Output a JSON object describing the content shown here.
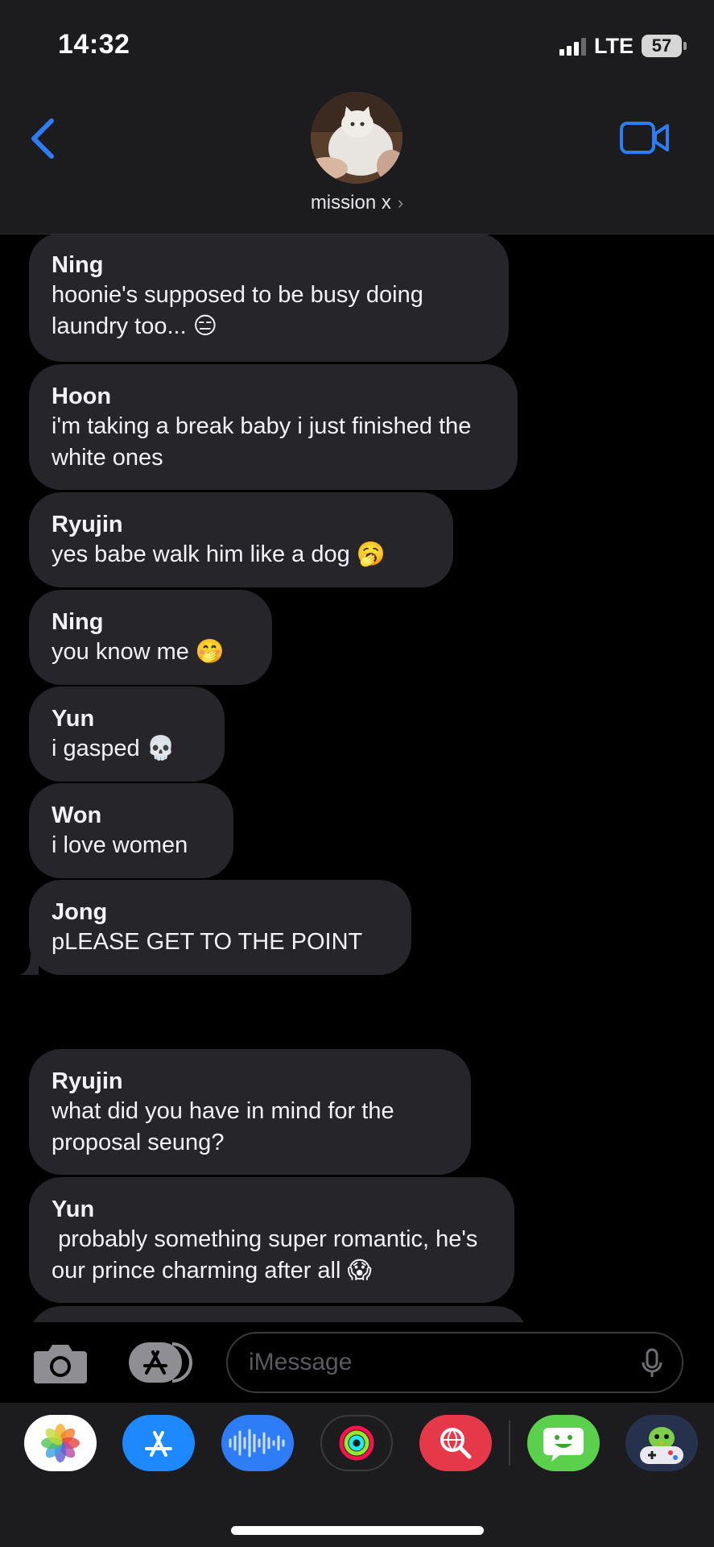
{
  "status_bar": {
    "time": "14:32",
    "network": "LTE",
    "battery": "57"
  },
  "header": {
    "group_name": "mission x",
    "chevron": "›"
  },
  "messages": [
    {
      "sender": "Ning",
      "text": "hoonie's supposed to be busy doing laundry too... 😑"
    },
    {
      "sender": "Hoon",
      "text": "i'm taking a break baby i just finished the white ones"
    },
    {
      "sender": "Ryujin",
      "text": "yes babe walk him like a dog 🥱"
    },
    {
      "sender": "Ning",
      "text": "you know me 🤭"
    },
    {
      "sender": "Yun",
      "text": "i gasped 💀"
    },
    {
      "sender": "Won",
      "text": "i love women"
    },
    {
      "sender": "Jong",
      "text": "pLEASE GET TO THE POINT"
    },
    {
      "sender": "Ryujin",
      "text": "what did you have in mind for the proposal seung?"
    },
    {
      "sender": "Yun",
      "text": " probably something super romantic, he's our prince charming after all 😱"
    }
  ],
  "composer": {
    "placeholder": "iMessage"
  },
  "app_drawer": {
    "apps": [
      {
        "name": "photos-app-icon",
        "bg": "#ffffff"
      },
      {
        "name": "app-store-icon",
        "bg": "#1e88ff"
      },
      {
        "name": "audio-message-icon",
        "bg": "#2f7df6"
      },
      {
        "name": "activity-icon",
        "bg": "#1c1c1e"
      },
      {
        "name": "image-search-icon",
        "bg": "#e5394a"
      },
      {
        "name": "sticker-app-icon",
        "bg": "#5ad04c"
      },
      {
        "name": "game-app-icon",
        "bg": "#26324d"
      }
    ]
  },
  "colors": {
    "accent": "#2f7df6",
    "bubble": "#26252a",
    "header": "#1c1c1e"
  }
}
